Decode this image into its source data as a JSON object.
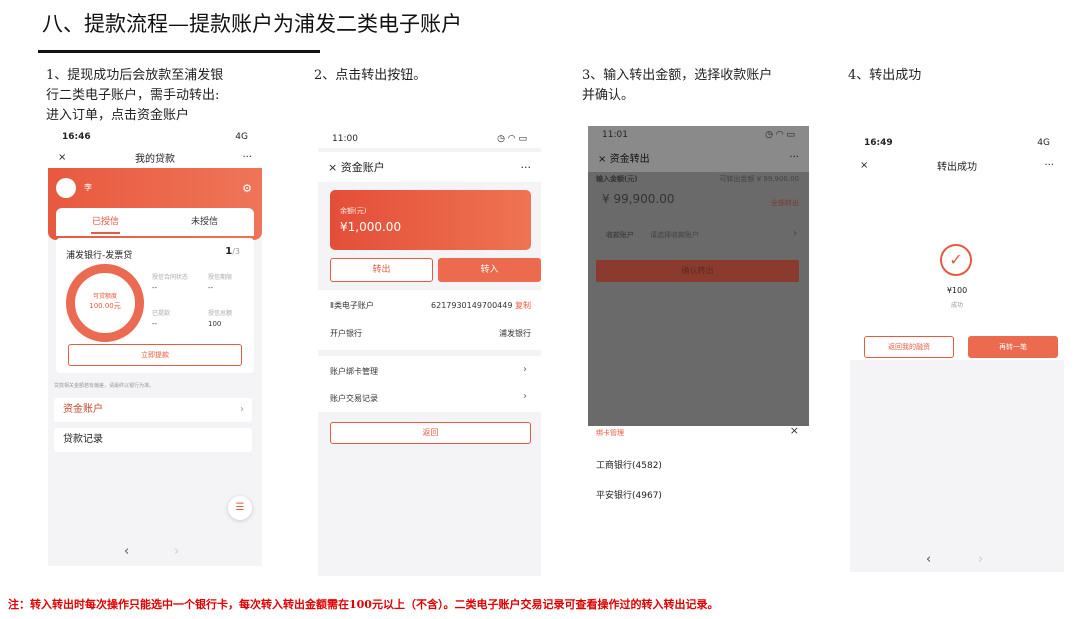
{
  "title": "八、提款流程—提款账户为浦发二类电子账户",
  "steps": [
    {
      "lines": [
        "1、提现成功后会放款至浦发银",
        "行二类电子账户，需手动转出:",
        "进入订单，点击资金账户"
      ]
    },
    {
      "lines": [
        "2、点击转出按钮。"
      ]
    },
    {
      "lines": [
        "3、输入转出金额，选择收款账户",
        "并确认。"
      ]
    },
    {
      "lines": [
        "4、转出成功"
      ]
    }
  ],
  "phone1": {
    "time": "16:46",
    "signal": "4G",
    "nav_close": "×",
    "nav_title": "我的贷款",
    "nav_more": "···",
    "user_name": "李",
    "tabs": [
      "已授信",
      "未授信"
    ],
    "bank_product": "浦发银行-发票贷",
    "page_current": "1",
    "page_total": "/3",
    "ring_label": "可贷额度",
    "ring_value": "100.00元",
    "stats": [
      {
        "label": "授信合同状态",
        "value": "--"
      },
      {
        "label": "授信期限",
        "value": "--"
      },
      {
        "label": "已提款",
        "value": "--"
      },
      {
        "label": "授信总额",
        "value": "100"
      }
    ],
    "apply_button": "立即提款",
    "note": "贷款相关金额若有偏差，请最终以银行为准。",
    "rows": [
      "资金账户",
      "贷款记录"
    ],
    "back": "‹",
    "forward": "›"
  },
  "phone2": {
    "time": "11:00",
    "nav_title": "资金账户",
    "nav_close": "×",
    "nav_more": "···",
    "balance_label": "余额(元)",
    "balance": "¥1,000.00",
    "out_button": "转出",
    "in_button": "转入",
    "account_label": "Ⅱ类电子账户",
    "account_number": "6217930149700449",
    "copy": "复制",
    "bank_label": "开户银行",
    "bank_value": "浦发银行",
    "menu": [
      "账户绑卡管理",
      "账户交易记录"
    ],
    "return_button": "返回"
  },
  "phone3": {
    "time": "11:01",
    "nav_close": "×",
    "nav_title": "资金转出",
    "nav_more": "···",
    "input_label": "输入金额(元)",
    "input_hint": "可转出金额 ¥ 99,900.00",
    "amount": "¥ 99,900.00",
    "all_link": "全部转出",
    "payee_label": "收款账户",
    "payee_hint": "请选择收款账户",
    "confirm": "确认转出",
    "sheet_title": "绑卡管理",
    "sheet_close": "×",
    "banks": [
      "工商银行(4582)",
      "平安银行(4967)"
    ]
  },
  "phone4": {
    "time": "16:49",
    "signal": "4G",
    "nav_close": "×",
    "nav_title": "转出成功",
    "nav_more": "···",
    "amount": "¥100",
    "status": "成功",
    "back_button": "返回我的融资",
    "again_button": "再转一笔",
    "back": "‹",
    "forward": "›"
  },
  "footnote": "注：转入转出时每次操作只能选中一个银行卡，每次转入转出金额需在100元以上（不含）。二类电子账户交易记录可查看操作过的转入转出记录。"
}
